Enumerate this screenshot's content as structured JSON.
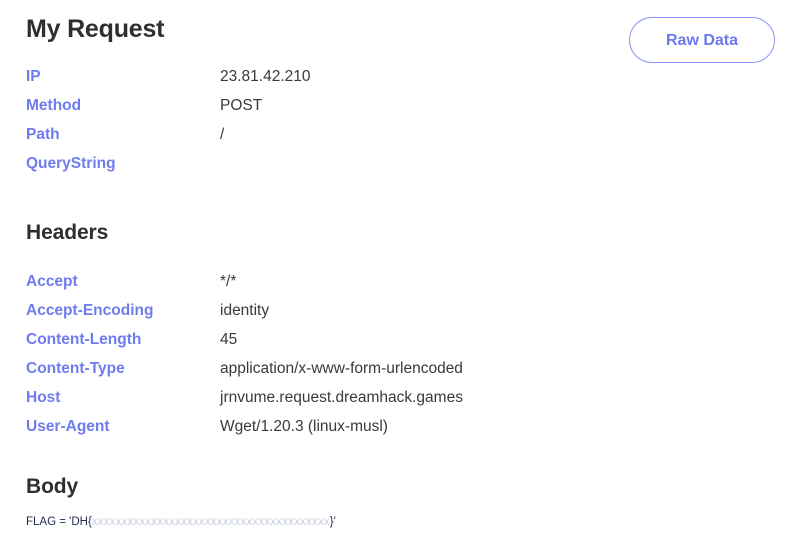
{
  "header": {
    "title": "My Request",
    "raw_data_label": "Raw Data"
  },
  "request": {
    "rows": [
      {
        "key": "IP",
        "value": "23.81.42.210"
      },
      {
        "key": "Method",
        "value": "POST"
      },
      {
        "key": "Path",
        "value": "/"
      },
      {
        "key": "QueryString",
        "value": ""
      }
    ]
  },
  "headers_section": {
    "title": "Headers",
    "rows": [
      {
        "key": "Accept",
        "value": "*/*"
      },
      {
        "key": "Accept-Encoding",
        "value": "identity"
      },
      {
        "key": "Content-Length",
        "value": "45"
      },
      {
        "key": "Content-Type",
        "value": "application/x-www-form-urlencoded"
      },
      {
        "key": "Host",
        "value": "jrnvume.request.dreamhack.games"
      },
      {
        "key": "User-Agent",
        "value": "Wget/1.20.3 (linux-musl)"
      }
    ]
  },
  "body_section": {
    "title": "Body",
    "prefix": "FLAG = 'DH{",
    "redacted": "xxxxxxxxxxxxxxxxxxxxxxxxxxxxxxxxxxxxxxxx",
    "suffix": "}'"
  },
  "colors": {
    "label": "#6f7cf0",
    "accent": "#8e93f5",
    "heading": "#2f2f2f",
    "value": "#3a3a3a",
    "background": "#ffffff"
  }
}
